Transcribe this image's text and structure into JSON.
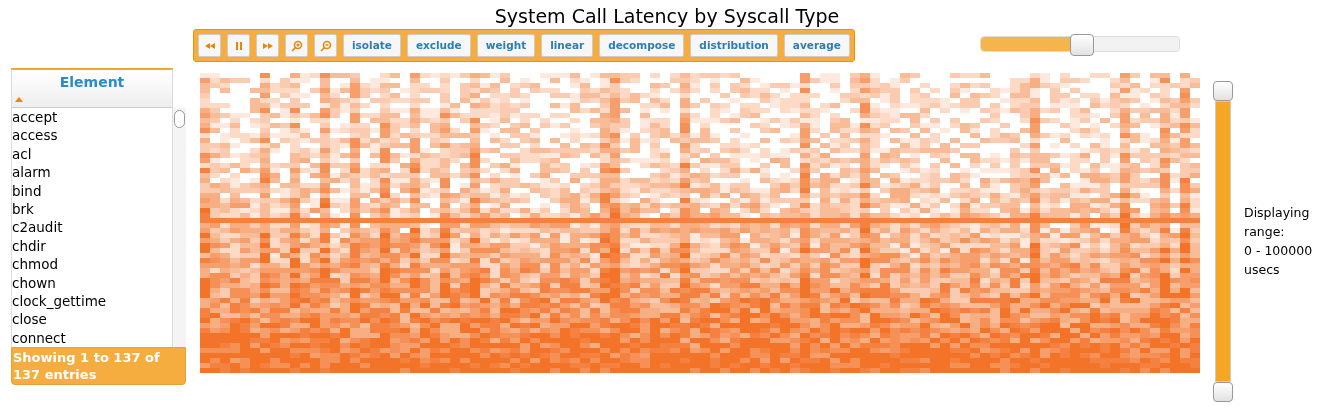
{
  "title": "System Call Latency by Syscall Type",
  "table": {
    "column": "Element",
    "rows": [
      "accept",
      "access",
      "acl",
      "alarm",
      "bind",
      "brk",
      "c2audit",
      "chdir",
      "chmod",
      "chown",
      "clock_gettime",
      "close",
      "connect"
    ],
    "footer": "Showing 1 to 137 of 137 entries"
  },
  "toolbar": [
    {
      "kind": "icon"
    },
    {
      "kind": "icon"
    },
    {
      "kind": "icon"
    },
    {
      "kind": "icon"
    },
    {
      "kind": "icon"
    },
    {
      "kind": "text",
      "label": "isolate"
    },
    {
      "kind": "text",
      "label": "exclude"
    },
    {
      "kind": "text",
      "label": "weight"
    },
    {
      "kind": "text",
      "label": "linear"
    },
    {
      "kind": "text",
      "label": "decompose"
    },
    {
      "kind": "text",
      "label": "distribution"
    },
    {
      "kind": "text",
      "label": "average"
    }
  ],
  "zoom_slider": {
    "level": 0.51
  },
  "range_slider": {
    "level": 1
  },
  "range_label": [
    "Displaying",
    "range:",
    "0 - 100000",
    "usecs"
  ]
}
